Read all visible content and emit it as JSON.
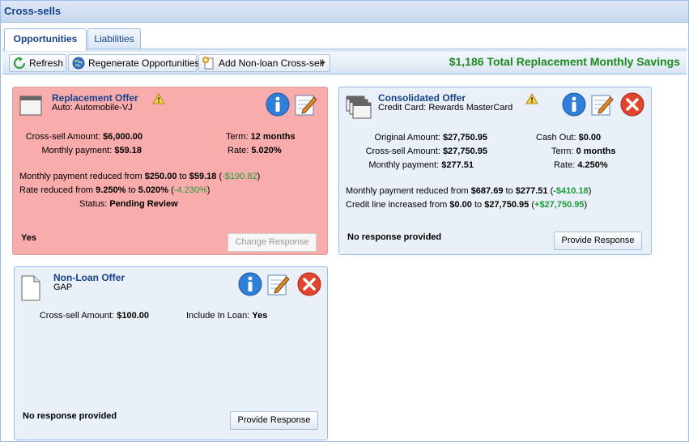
{
  "window": {
    "title": "Cross-sells"
  },
  "tabs": [
    {
      "label": "Opportunities"
    },
    {
      "label": "Liabilities"
    }
  ],
  "toolbar": {
    "refresh_label": "Refresh",
    "regenerate_label": "Regenerate Opportunities",
    "add_label": "Add Non-loan Cross-sell",
    "savings_text": "$1,186 Total Replacement Monthly Savings"
  },
  "cards": {
    "replacement": {
      "title": "Replacement Offer",
      "subtitle": "Auto: Automobile-VJ",
      "cross_sell_label": "Cross-sell Amount:",
      "cross_sell_value": "$6,000.00",
      "monthly_label": "Monthly payment:",
      "monthly_value": "$59.18",
      "term_label": "Term:",
      "term_value": "12 months",
      "rate_label": "Rate:",
      "rate_value": "5.020%",
      "line1_prefix": "Monthly payment reduced from ",
      "line1_from": "$250.00",
      "line1_to_word": " to ",
      "line1_to": "$59.18",
      "line1_delta_open": " (",
      "line1_delta": "-$190.82",
      "line1_delta_close": ")",
      "line2_prefix": "Rate reduced from ",
      "line2_from": "9.250%",
      "line2_to_word": " to ",
      "line2_to": "5.020%",
      "line2_delta_open": " (",
      "line2_delta": "-4.230%",
      "line2_delta_close": ")",
      "status_label": "Status:",
      "status_value": "Pending Review",
      "response": "Yes",
      "button": "Change Response"
    },
    "consolidated": {
      "title": "Consolidated Offer",
      "subtitle": "Credit Card: Rewards MasterCard",
      "original_label": "Original Amount:",
      "original_value": "$27,750.95",
      "cross_sell_label": "Cross-sell Amount:",
      "cross_sell_value": "$27,750.95",
      "monthly_label": "Monthly payment:",
      "monthly_value": "$277.51",
      "cashout_label": "Cash Out:",
      "cashout_value": "$0.00",
      "term_label": "Term:",
      "term_value": "0 months",
      "rate_label": "Rate:",
      "rate_value": "4.250%",
      "line1_prefix": "Monthly payment reduced from ",
      "line1_from": "$687.69",
      "line1_to_word": " to ",
      "line1_to": "$277.51",
      "line1_delta_open": " (",
      "line1_delta": "-$410.18",
      "line1_delta_close": ")",
      "line2_prefix": "Credit line increased from ",
      "line2_from": "$0.00",
      "line2_to_word": " to ",
      "line2_to": "$27,750.95",
      "line2_delta_open": " (",
      "line2_delta": "+$27,750.95",
      "line2_delta_close": ")",
      "response": "No response provided",
      "button": "Provide Response"
    },
    "nonloan": {
      "title": "Non-Loan Offer",
      "subtitle": "GAP",
      "cross_sell_label": "Cross-sell Amount:",
      "cross_sell_value": "$100.00",
      "include_label": "Include In Loan:",
      "include_value": "Yes",
      "response": "No response provided",
      "button": "Provide Response"
    }
  },
  "colors": {
    "accent": "#15428b",
    "savings": "#1d8a1d",
    "delta_green": "#1d9c3a",
    "warn_bg": "#f9acac",
    "card_bg": "#e9f0f8"
  }
}
